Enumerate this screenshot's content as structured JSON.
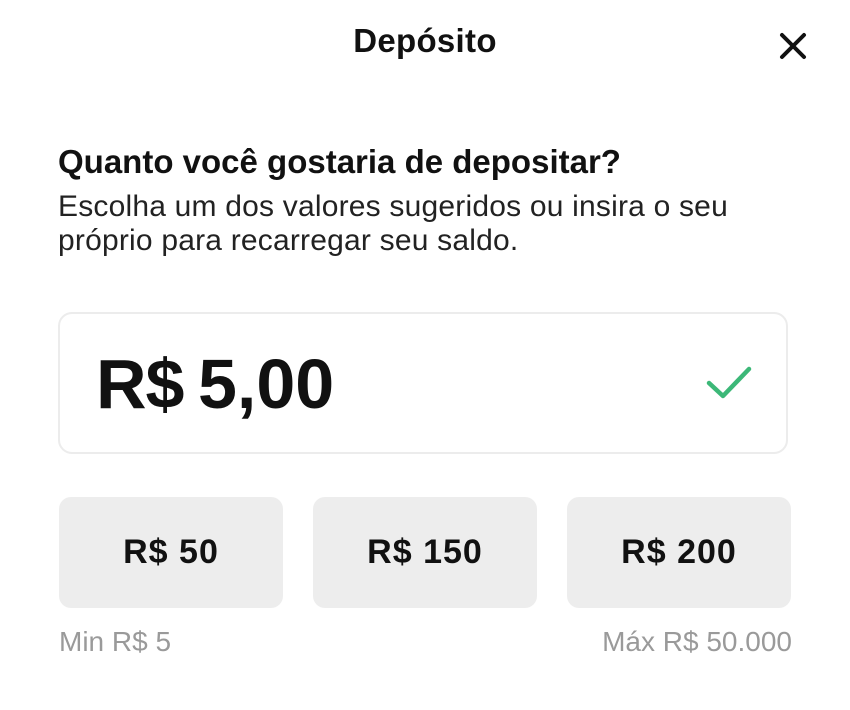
{
  "header": {
    "title": "Depósito",
    "close_icon": "close-icon"
  },
  "prompt": {
    "question": "Quanto você gostaria de depositar?",
    "description": "Escolha um dos valores sugeridos ou insira o seu próprio para recarregar seu saldo."
  },
  "amount_input": {
    "currency": "R$",
    "value": "5,00",
    "status_icon": "check-icon",
    "status_color": "#3cb878"
  },
  "quick_amounts": [
    {
      "label": "R$ 50"
    },
    {
      "label": "R$ 150"
    },
    {
      "label": "R$ 200"
    }
  ],
  "limits": {
    "min": "Min R$ 5",
    "max": "Máx R$ 50.000"
  },
  "colors": {
    "button_bg": "#ededed",
    "limit_text": "#9a9a9a",
    "input_border": "#ececec"
  }
}
